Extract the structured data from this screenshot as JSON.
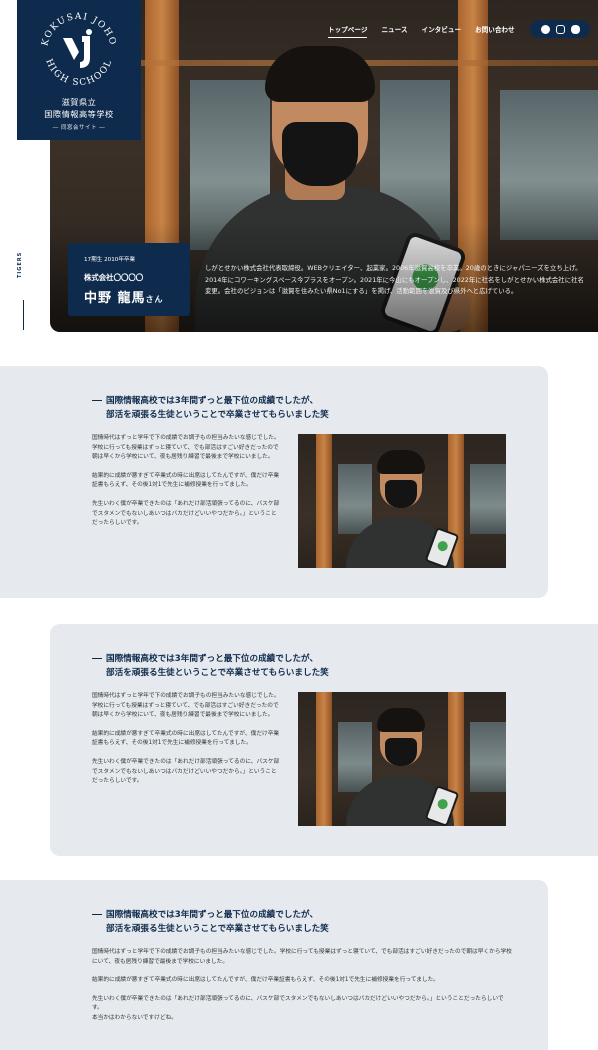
{
  "site": {
    "logo_text": "KOKUSAI JOHO HIGH SCHOOL",
    "school_name_line1": "滋賀県立",
    "school_name_line2": "国際情報高等学校",
    "subtitle": "― 同窓会サイト ―"
  },
  "nav": {
    "items": [
      {
        "label": "トップページ"
      },
      {
        "label": "ニュース"
      },
      {
        "label": "インタビュー"
      },
      {
        "label": "お問い合わせ"
      }
    ],
    "social": [
      "facebook-icon",
      "instagram-icon",
      "line-icon"
    ]
  },
  "hero": {
    "vertical_label": "TIGERS",
    "grad": "17期生 2010年卒業",
    "company": "株式会社〇〇〇〇",
    "name": "中野 龍馬",
    "honorific": "さん",
    "bio": "しがとせかい株式会社代表取締役。WEBクリエイター、起業家。2006年滋賀高校を卒業。20歳のときにジャパニーズを立ち上げ。2014年にコワーキングスペース今プラスをオープン。2021年に今山にもオープンし、2022年に社名をしがとせかい株式会社に社名変更。会社のビジョンは「滋賀を住みたい県No1にする」を掲げ、活動範囲を滋賀及び県外へと広げている。"
  },
  "sections": [
    {
      "title_line1": "国際情報高校では3年間ずっと最下位の成績でしたが、",
      "title_line2": "部活を頑張る生徒ということで卒業させてもらいました笑",
      "paragraphs": [
        "国情時代はずっと学年で下の成績でお調子もの担当みたいな感じでした。学校に行っても授業はずっと寝ていて、でも部活はすごい好きだったので朝は早くから学校にいて、夜も居残り練習で最後まで学校にいました。",
        "結果的に成績が悪すぎて卒業式の時に出席はしてたんですが、僕だけ卒業証書もらえず、その後1対1で先生に補修授業を行ってました。",
        "先生いわく僕が卒業できたのは「あれだけ部活頑張ってるのに、バスケ部でスタメンでもないしあいつはバカだけどいいやつだから。」ということだったらしいです。"
      ]
    },
    {
      "title_line1": "国際情報高校では3年間ずっと最下位の成績でしたが、",
      "title_line2": "部活を頑張る生徒ということで卒業させてもらいました笑",
      "paragraphs": [
        "国情時代はずっと学年で下の成績でお調子もの担当みたいな感じでした。学校に行っても授業はずっと寝ていて、でも部活はすごい好きだったので朝は早くから学校にいて、夜も居残り練習で最後まで学校にいました。",
        "結果的に成績が悪すぎて卒業式の時に出席はしてたんですが、僕だけ卒業証書もらえず、その後1対1で先生に補修授業を行ってました。",
        "先生いわく僕が卒業できたのは「あれだけ部活頑張ってるのに、バスケ部でスタメンでもないしあいつはバカだけどいいやつだから。」ということだったらしいです。"
      ]
    },
    {
      "title_line1": "国際情報高校では3年間ずっと最下位の成績でしたが、",
      "title_line2": "部活を頑張る生徒ということで卒業させてもらいました笑",
      "paragraphs": [
        "国情時代はずっと学年で下の成績でお調子もの担当みたいな感じでした。学校に行っても授業はずっと寝ていて、でも部活はすごい好きだったので朝は早くから学校にいて、夜も居残り練習で最後まで学校にいました。",
        "結果的に成績が悪すぎて卒業式の時に出席はしてたんですが、僕だけ卒業証書もらえず、その後1対1で先生に補修授業を行ってました。",
        "先生いわく僕が卒業できたのは「あれだけ部活頑張ってるのに、バスケ部でスタメンでもないしあいつはバカだけどいいやつだから。」ということだったらしいです。",
        "本当かはわからないですけどね。"
      ]
    }
  ]
}
